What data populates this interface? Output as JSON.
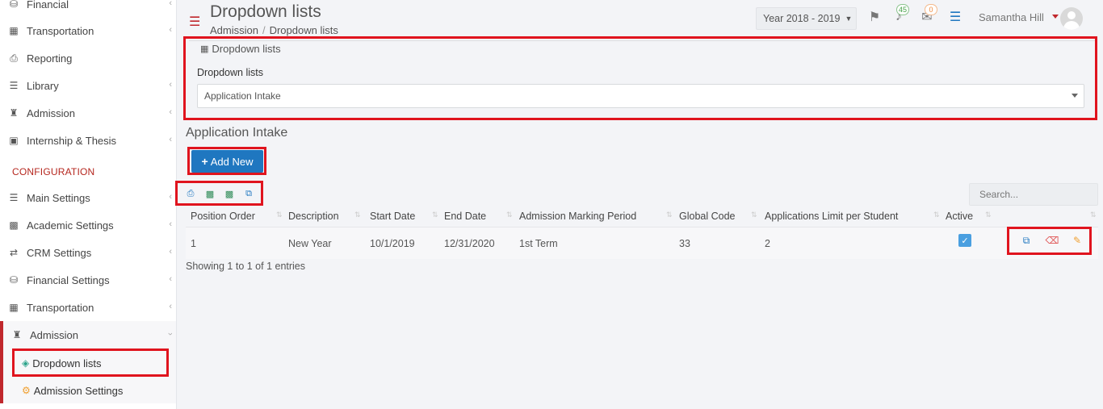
{
  "sidebar": {
    "items": [
      {
        "label": "Financial",
        "icon": "coins-icon"
      },
      {
        "label": "Transportation",
        "icon": "bus-icon"
      },
      {
        "label": "Reporting",
        "icon": "printer-icon"
      },
      {
        "label": "Library",
        "icon": "books-icon"
      },
      {
        "label": "Admission",
        "icon": "institution-icon"
      },
      {
        "label": "Internship & Thesis",
        "icon": "cube-icon"
      }
    ],
    "section_label": "CONFIGURATION",
    "config_items": [
      {
        "label": "Main Settings",
        "icon": "sliders-icon"
      },
      {
        "label": "Academic Settings",
        "icon": "sitemap-icon"
      },
      {
        "label": "CRM Settings",
        "icon": "shuffle-icon"
      },
      {
        "label": "Financial Settings",
        "icon": "coins-icon"
      },
      {
        "label": "Transportation",
        "icon": "bus-icon"
      },
      {
        "label": "Admission",
        "icon": "institution-icon"
      }
    ],
    "sub_items": [
      {
        "label": "Dropdown lists",
        "icon": "layers-icon"
      },
      {
        "label": "Admission Settings",
        "icon": "cogs-icon"
      }
    ]
  },
  "header": {
    "title": "Dropdown lists",
    "breadcrumb": [
      "Admission",
      "/",
      "Dropdown lists"
    ],
    "year": "Year 2018 - 2019",
    "notifications_count": "45",
    "messages_count": "0",
    "user_name": "Samantha Hill"
  },
  "panel": {
    "legend": "Dropdown lists",
    "label": "Dropdown lists",
    "selected": "Application Intake"
  },
  "section_title": "Application Intake",
  "add_button": "Add New",
  "search": {
    "placeholder": "Search..."
  },
  "table": {
    "columns": [
      "Position Order",
      "Description",
      "Start Date",
      "End Date",
      "Admission Marking Period",
      "Global Code",
      "Applications Limit per Student",
      "Active"
    ],
    "rows": [
      {
        "position_order": "1",
        "description": "New Year",
        "start_date": "10/1/2019",
        "end_date": "12/31/2020",
        "marking_period": "1st Term",
        "global_code": "33",
        "limit": "2",
        "active": true
      }
    ]
  },
  "footer": {
    "showing": "Showing 1 to 1 of 1 entries"
  },
  "colors": {
    "accent_red": "#c0282d",
    "primary_blue": "#1f77c0",
    "highlight": "#e0141e"
  }
}
